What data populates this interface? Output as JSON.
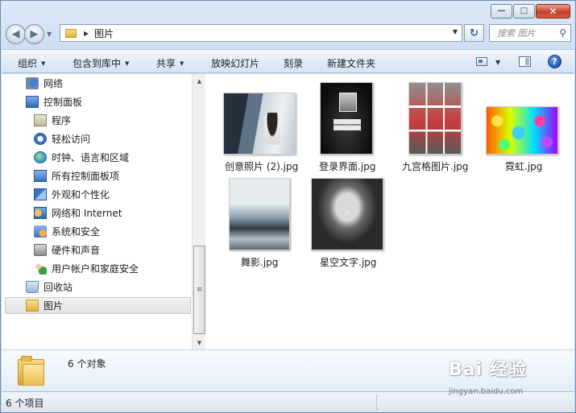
{
  "window": {
    "caption_buttons": {
      "minimize": "—",
      "maximize": "□",
      "close": "✕"
    }
  },
  "nav": {
    "back_glyph": "◀",
    "forward_glyph": "▶",
    "address_segment": "图片",
    "address_separator": "▶",
    "refresh_glyph": "↻",
    "search_placeholder": "搜索 图片"
  },
  "toolbar": {
    "items": [
      {
        "label": "组织",
        "has_dropdown": true
      },
      {
        "label": "包含到库中",
        "has_dropdown": true
      },
      {
        "label": "共享",
        "has_dropdown": true
      },
      {
        "label": "放映幻灯片",
        "has_dropdown": false
      },
      {
        "label": "刻录",
        "has_dropdown": false
      },
      {
        "label": "新建文件夹",
        "has_dropdown": false
      }
    ],
    "help_glyph": "?"
  },
  "sidebar": {
    "items": [
      {
        "label": "网络",
        "icon": "network-icon"
      },
      {
        "label": "控制面板",
        "icon": "control-panel-icon"
      },
      {
        "label": "程序",
        "icon": "programs-icon"
      },
      {
        "label": "轻松访问",
        "icon": "ease-of-access-icon"
      },
      {
        "label": "时钟、语言和区域",
        "icon": "clock-language-region-icon"
      },
      {
        "label": "所有控制面板项",
        "icon": "all-control-panel-items-icon"
      },
      {
        "label": "外观和个性化",
        "icon": "appearance-icon"
      },
      {
        "label": "网络和 Internet",
        "icon": "network-internet-icon"
      },
      {
        "label": "系统和安全",
        "icon": "system-security-icon"
      },
      {
        "label": "硬件和声音",
        "icon": "hardware-sound-icon"
      },
      {
        "label": "用户帐户和家庭安全",
        "icon": "user-accounts-icon"
      },
      {
        "label": "回收站",
        "icon": "recycle-bin-icon"
      },
      {
        "label": "图片",
        "icon": "folder-icon",
        "selected": true
      }
    ]
  },
  "files": [
    {
      "name": "创意照片 (2).jpg"
    },
    {
      "name": "登录界面.jpg"
    },
    {
      "name": "九宫格图片.jpg"
    },
    {
      "name": "霓虹.jpg"
    },
    {
      "name": "舞影.jpg"
    },
    {
      "name": "星空文字.jpg"
    }
  ],
  "details": {
    "count_text": "6 个对象"
  },
  "status": {
    "text": "6 个项目"
  },
  "watermark": {
    "text": "Bai 经验",
    "url": "jingyan.baidu.com"
  }
}
